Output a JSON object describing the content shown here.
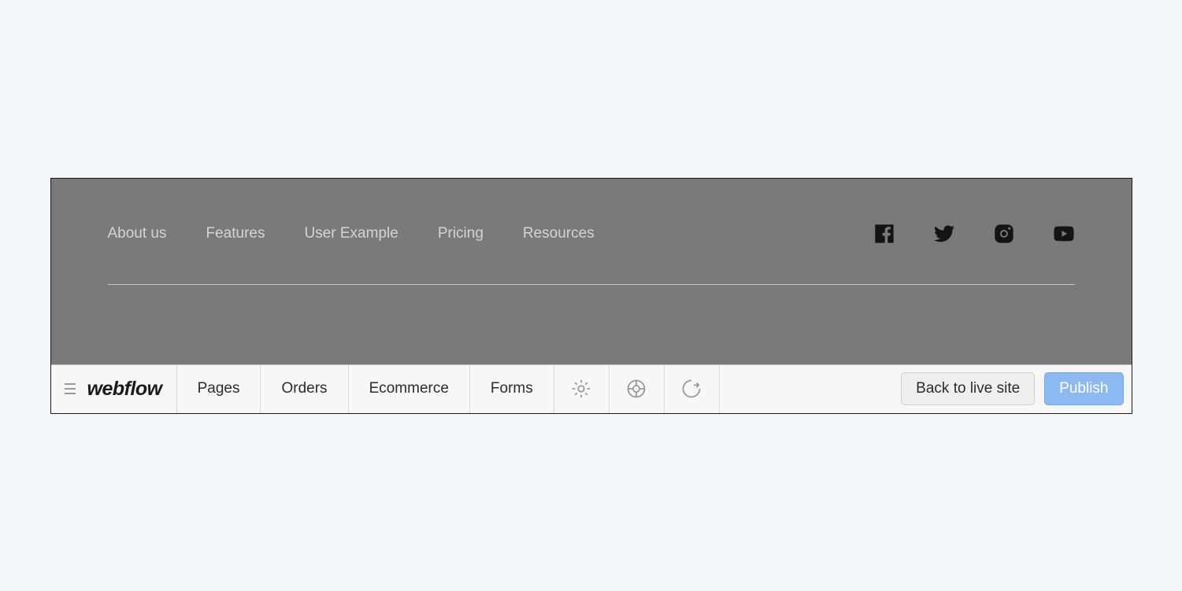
{
  "preview": {
    "nav": {
      "links": [
        {
          "label": "About us"
        },
        {
          "label": "Features"
        },
        {
          "label": "User Example"
        },
        {
          "label": "Pricing"
        },
        {
          "label": "Resources"
        }
      ]
    },
    "social": {
      "facebook": "facebook-icon",
      "twitter": "twitter-icon",
      "instagram": "instagram-icon",
      "youtube": "youtube-icon"
    }
  },
  "editor": {
    "logo_text": "webflow",
    "tabs": [
      {
        "label": "Pages"
      },
      {
        "label": "Orders"
      },
      {
        "label": "Ecommerce"
      },
      {
        "label": "Forms"
      }
    ],
    "icon_tabs": {
      "settings": "gear-icon",
      "help": "help-icon",
      "logout": "logout-icon"
    },
    "buttons": {
      "back_to_live": "Back to live site",
      "publish": "Publish"
    }
  }
}
